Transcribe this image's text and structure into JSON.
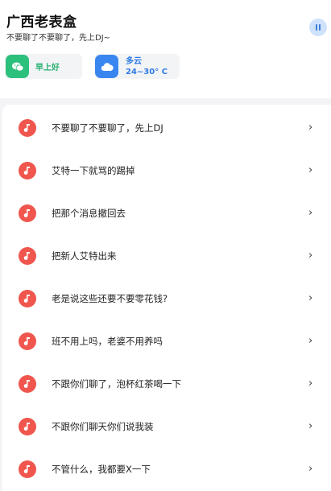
{
  "header": {
    "title": "广西老表盒",
    "subtitle": "不要聊了不要聊了，先上DJ~"
  },
  "chips": {
    "greeting": {
      "text": "早上好",
      "icon": "chat-icon"
    },
    "weather": {
      "line1": "多云",
      "line2": "24~30° C",
      "icon": "cloud-icon"
    }
  },
  "list": {
    "items": [
      {
        "label": "不要聊了不要聊了，先上DJ"
      },
      {
        "label": "艾特一下就骂的踢掉"
      },
      {
        "label": "把那个消息撤回去"
      },
      {
        "label": "把新人艾特出来"
      },
      {
        "label": "老是说这些还要不要零花钱?"
      },
      {
        "label": "班不用上吗，老婆不用养吗"
      },
      {
        "label": "不跟你们聊了，泡杯红茶喝一下"
      },
      {
        "label": "不跟你们聊天你们说我装"
      },
      {
        "label": "不管什么，我都要X一下"
      }
    ],
    "chevron": "›"
  },
  "colors": {
    "accent_green": "#2cc07d",
    "accent_blue": "#3a86f0",
    "item_icon_red": "#f0564d"
  }
}
